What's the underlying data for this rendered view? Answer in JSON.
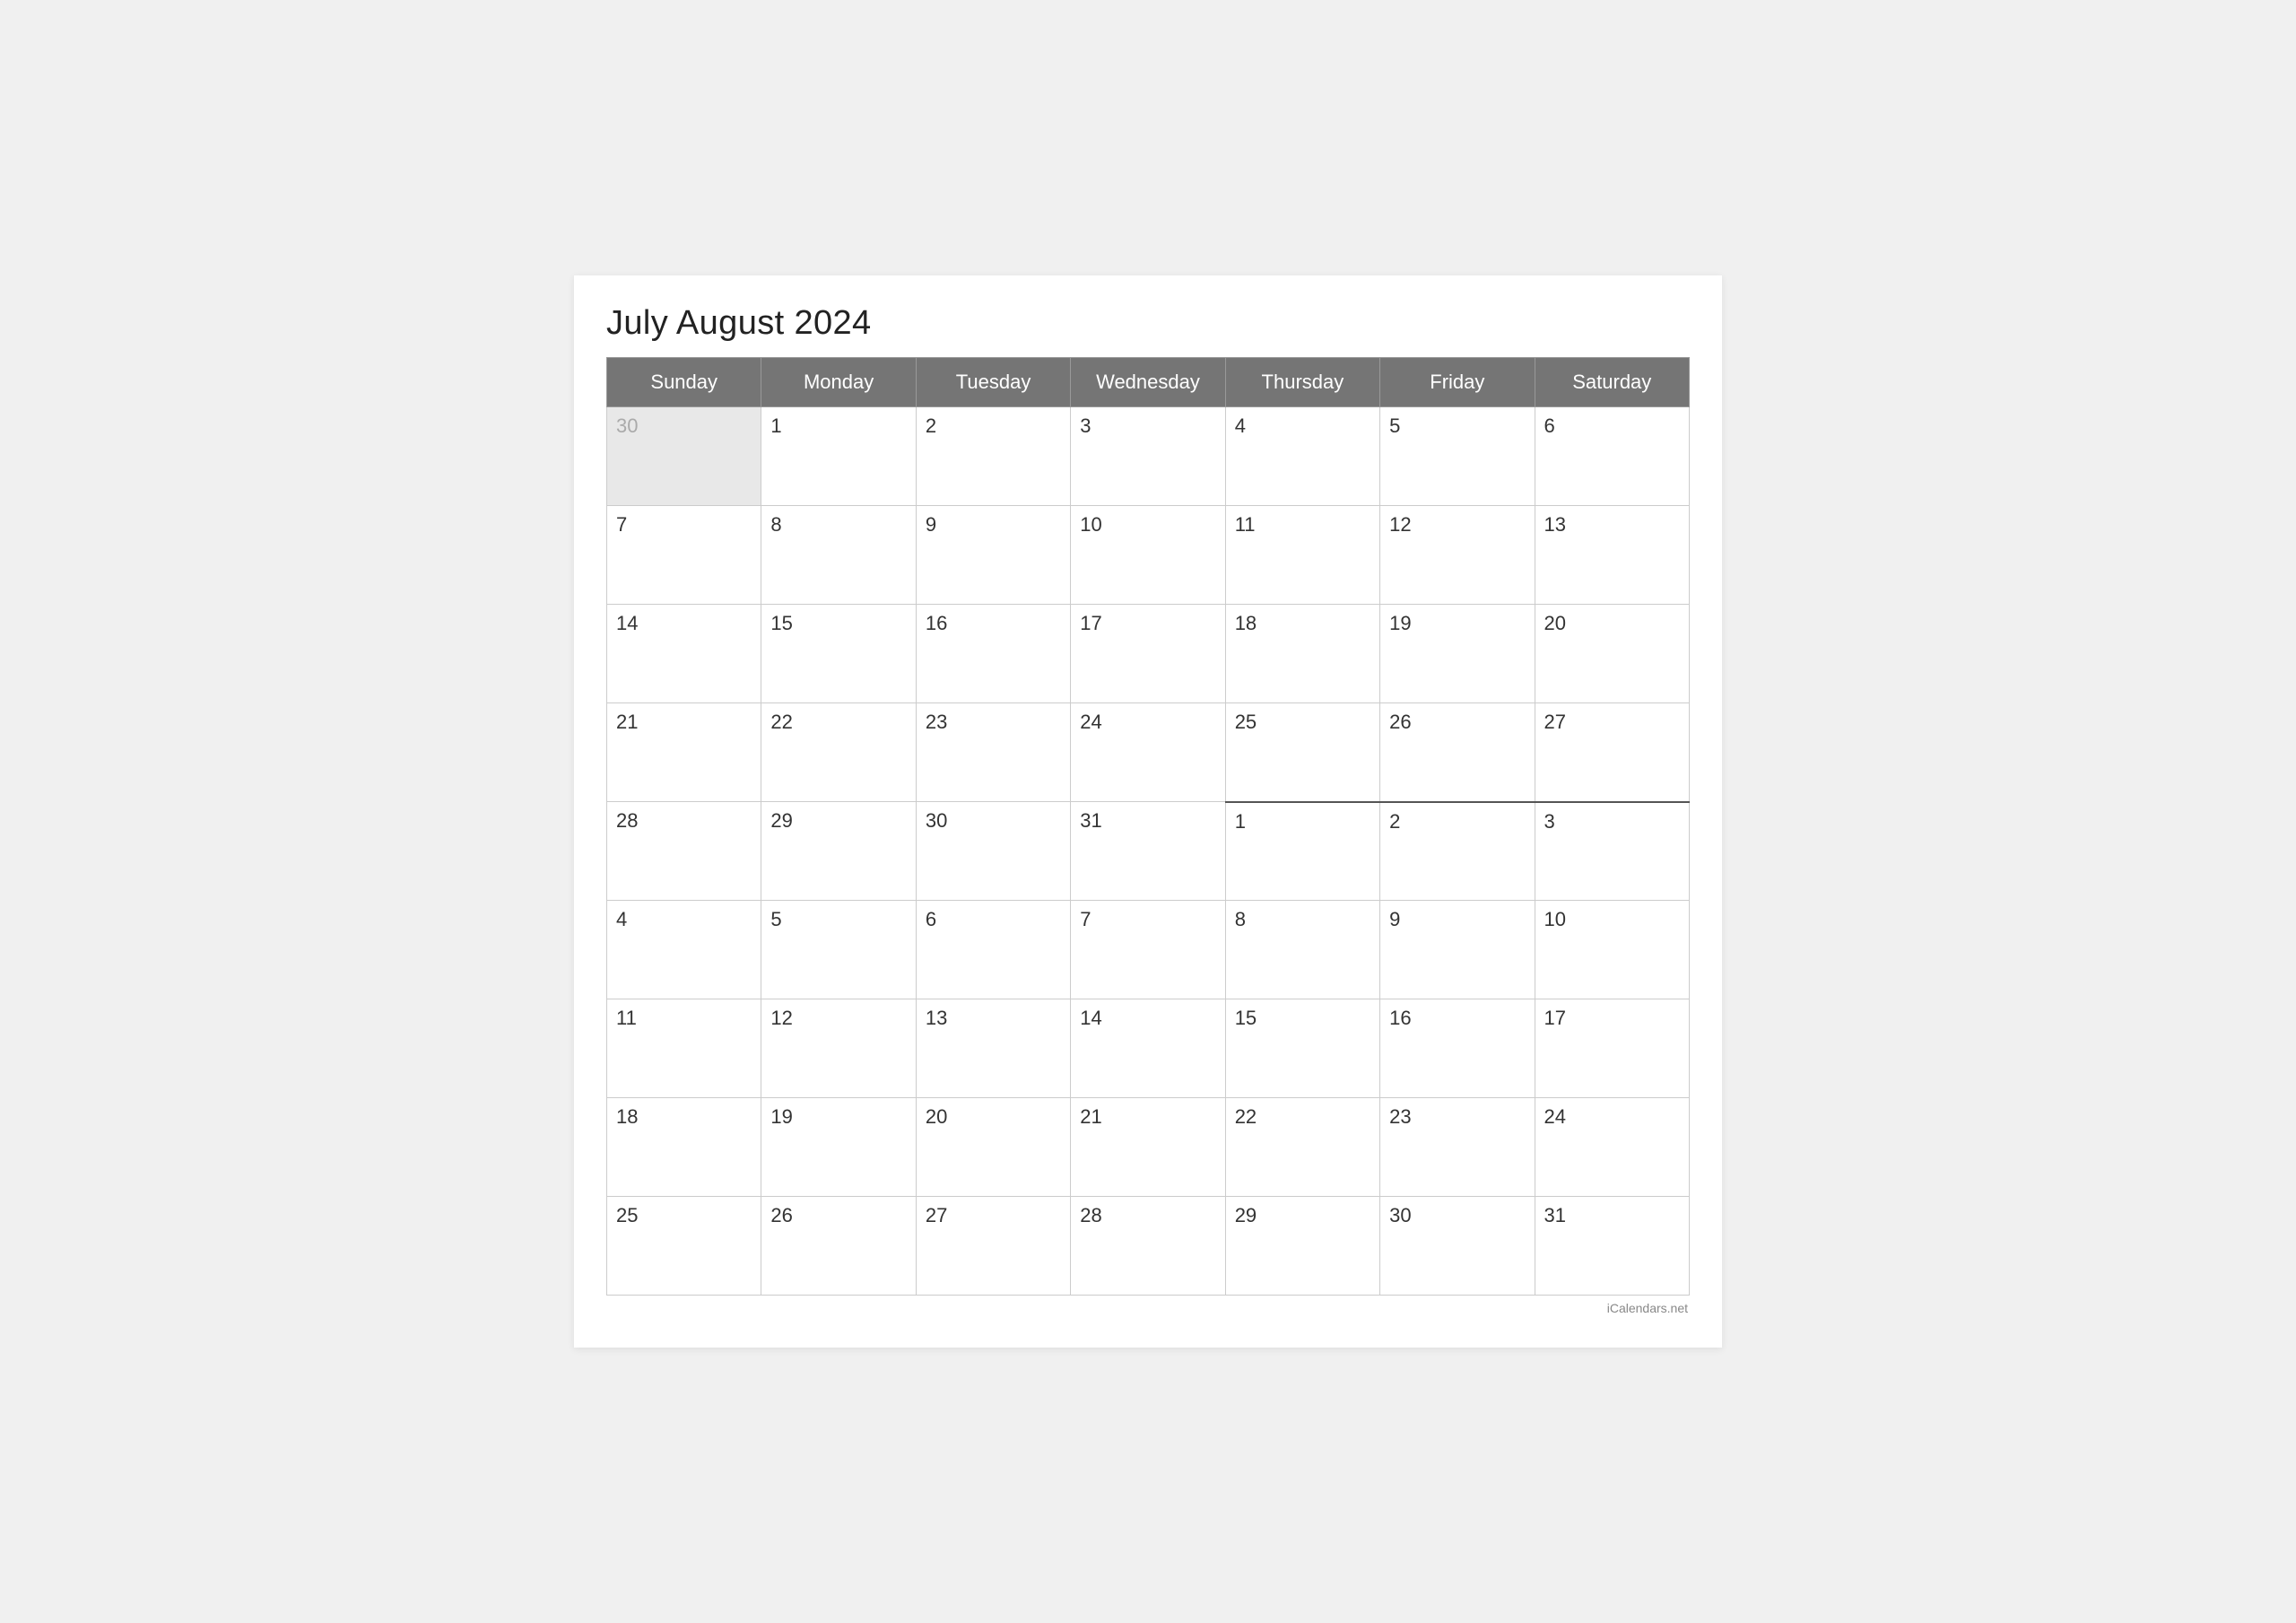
{
  "calendar": {
    "title": "July August 2024",
    "days_of_week": [
      "Sunday",
      "Monday",
      "Tuesday",
      "Wednesday",
      "Thursday",
      "Friday",
      "Saturday"
    ],
    "weeks": [
      [
        {
          "day": "30",
          "type": "prev-month"
        },
        {
          "day": "1",
          "type": "current"
        },
        {
          "day": "2",
          "type": "current"
        },
        {
          "day": "3",
          "type": "current"
        },
        {
          "day": "4",
          "type": "current"
        },
        {
          "day": "5",
          "type": "current"
        },
        {
          "day": "6",
          "type": "current"
        }
      ],
      [
        {
          "day": "7",
          "type": "current"
        },
        {
          "day": "8",
          "type": "current"
        },
        {
          "day": "9",
          "type": "current"
        },
        {
          "day": "10",
          "type": "current"
        },
        {
          "day": "11",
          "type": "current"
        },
        {
          "day": "12",
          "type": "current"
        },
        {
          "day": "13",
          "type": "current"
        }
      ],
      [
        {
          "day": "14",
          "type": "current"
        },
        {
          "day": "15",
          "type": "current"
        },
        {
          "day": "16",
          "type": "current"
        },
        {
          "day": "17",
          "type": "current"
        },
        {
          "day": "18",
          "type": "current"
        },
        {
          "day": "19",
          "type": "current"
        },
        {
          "day": "20",
          "type": "current"
        }
      ],
      [
        {
          "day": "21",
          "type": "current"
        },
        {
          "day": "22",
          "type": "current"
        },
        {
          "day": "23",
          "type": "current"
        },
        {
          "day": "24",
          "type": "current"
        },
        {
          "day": "25",
          "type": "current"
        },
        {
          "day": "26",
          "type": "current"
        },
        {
          "day": "27",
          "type": "current"
        }
      ],
      [
        {
          "day": "28",
          "type": "current"
        },
        {
          "day": "29",
          "type": "current"
        },
        {
          "day": "30",
          "type": "current"
        },
        {
          "day": "31",
          "type": "current"
        },
        {
          "day": "1",
          "type": "next-month-divider"
        },
        {
          "day": "2",
          "type": "next-month-divider"
        },
        {
          "day": "3",
          "type": "next-month-divider"
        }
      ],
      [
        {
          "day": "4",
          "type": "next-month"
        },
        {
          "day": "5",
          "type": "next-month"
        },
        {
          "day": "6",
          "type": "next-month"
        },
        {
          "day": "7",
          "type": "next-month"
        },
        {
          "day": "8",
          "type": "next-month"
        },
        {
          "day": "9",
          "type": "next-month"
        },
        {
          "day": "10",
          "type": "next-month"
        }
      ],
      [
        {
          "day": "11",
          "type": "next-month"
        },
        {
          "day": "12",
          "type": "next-month"
        },
        {
          "day": "13",
          "type": "next-month"
        },
        {
          "day": "14",
          "type": "next-month"
        },
        {
          "day": "15",
          "type": "next-month"
        },
        {
          "day": "16",
          "type": "next-month"
        },
        {
          "day": "17",
          "type": "next-month"
        }
      ],
      [
        {
          "day": "18",
          "type": "next-month"
        },
        {
          "day": "19",
          "type": "next-month"
        },
        {
          "day": "20",
          "type": "next-month"
        },
        {
          "day": "21",
          "type": "next-month"
        },
        {
          "day": "22",
          "type": "next-month"
        },
        {
          "day": "23",
          "type": "next-month"
        },
        {
          "day": "24",
          "type": "next-month"
        }
      ],
      [
        {
          "day": "25",
          "type": "next-month"
        },
        {
          "day": "26",
          "type": "next-month"
        },
        {
          "day": "27",
          "type": "next-month"
        },
        {
          "day": "28",
          "type": "next-month"
        },
        {
          "day": "29",
          "type": "next-month"
        },
        {
          "day": "30",
          "type": "next-month"
        },
        {
          "day": "31",
          "type": "next-month"
        }
      ]
    ],
    "watermark": "iCalendars.net"
  }
}
